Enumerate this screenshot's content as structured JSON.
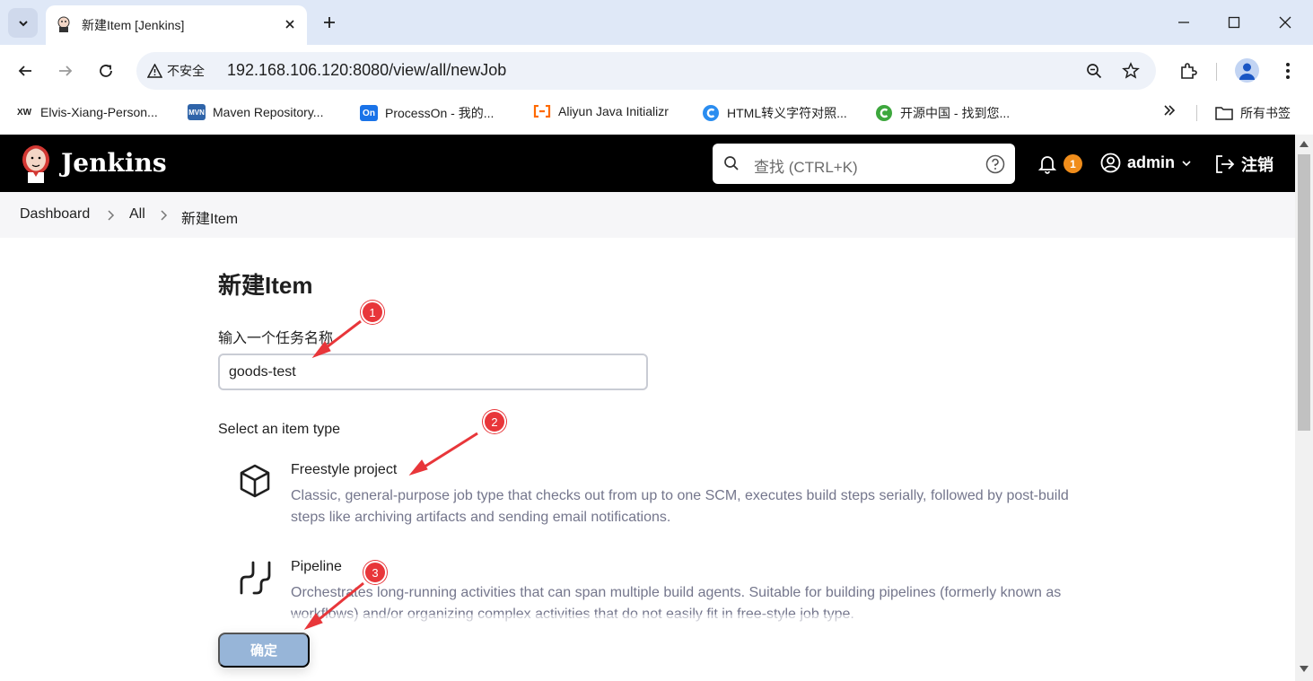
{
  "browser": {
    "tab_title": "新建Item [Jenkins]",
    "security_label": "不安全",
    "url": "192.168.106.120:8080/view/all/newJob",
    "bookmarks": [
      {
        "icon": "XW",
        "label": "Elvis-Xiang-Person..."
      },
      {
        "icon": "MVN",
        "label": "Maven Repository..."
      },
      {
        "icon": "On",
        "label": "ProcessOn - 我的..."
      },
      {
        "icon": "aliyun",
        "label": "Aliyun Java Initializr"
      },
      {
        "icon": "C",
        "label": "HTML转义字符对照..."
      },
      {
        "icon": "C",
        "label": "开源中国 - 找到您..."
      }
    ],
    "all_bookmarks_label": "所有书签"
  },
  "jenkins": {
    "brand": "Jenkins",
    "search_placeholder": "查找 (CTRL+K)",
    "notification_count": "1",
    "username": "admin",
    "logout_label": "注销"
  },
  "breadcrumb": [
    "Dashboard",
    "All",
    "新建Item"
  ],
  "page": {
    "title": "新建Item",
    "name_label": "输入一个任务名称",
    "name_value": "goods-test",
    "item_type_label": "Select an item type",
    "items": [
      {
        "title": "Freestyle project",
        "description": "Classic, general-purpose job type that checks out from up to one SCM, executes build steps serially, followed by post-build steps like archiving artifacts and sending email notifications."
      },
      {
        "title": "Pipeline",
        "description": "Orchestrates long-running activities that can span multiple build agents. Suitable for building pipelines (formerly known as workflows) and/or organizing complex activities that do not easily fit in free-style job type."
      }
    ],
    "ok_label": "确定"
  },
  "annotations": [
    "1",
    "2",
    "3"
  ],
  "colors": {
    "header_bg": "#000000",
    "badge": "#f08d1b",
    "ok_button": "#97b5d8",
    "annotation": "#e8363a",
    "description_text": "#74768c"
  }
}
